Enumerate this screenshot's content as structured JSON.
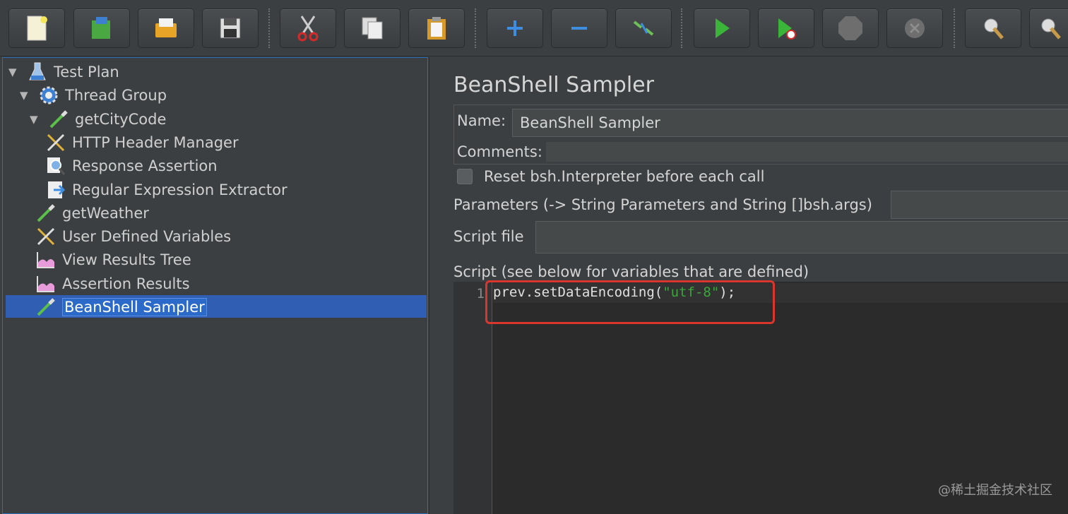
{
  "toolbar": {
    "buttons": [
      {
        "name": "new",
        "icon": "new-file-icon"
      },
      {
        "name": "templates",
        "icon": "templates-icon"
      },
      {
        "name": "open",
        "icon": "open-folder-icon"
      },
      {
        "name": "save",
        "icon": "save-icon"
      },
      {
        "name": "cut",
        "icon": "cut-icon"
      },
      {
        "name": "copy",
        "icon": "copy-icon"
      },
      {
        "name": "paste",
        "icon": "paste-icon"
      },
      {
        "name": "expand",
        "icon": "plus-icon"
      },
      {
        "name": "collapse",
        "icon": "minus-icon"
      },
      {
        "name": "toggle",
        "icon": "toggle-icon"
      },
      {
        "name": "start",
        "icon": "play-icon"
      },
      {
        "name": "start-no-pauses",
        "icon": "play-no-timers-icon"
      },
      {
        "name": "stop",
        "icon": "stop-icon"
      },
      {
        "name": "shutdown",
        "icon": "shutdown-icon"
      },
      {
        "name": "clear",
        "icon": "broom-icon"
      },
      {
        "name": "clear-all",
        "icon": "broom-all-icon"
      }
    ]
  },
  "tree": {
    "items": [
      {
        "label": "Test Plan",
        "icon": "flask-icon",
        "arrow": "▼"
      },
      {
        "label": "Thread Group",
        "icon": "gear-icon",
        "arrow": "▼"
      },
      {
        "label": "getCityCode",
        "icon": "pipette-icon",
        "arrow": "▼"
      },
      {
        "label": "HTTP Header Manager",
        "icon": "tools-icon",
        "arrow": ""
      },
      {
        "label": "Response Assertion",
        "icon": "magnifier-icon",
        "arrow": ""
      },
      {
        "label": "Regular Expression Extractor",
        "icon": "extractor-icon",
        "arrow": ""
      },
      {
        "label": "getWeather",
        "icon": "pipette-icon",
        "arrow": ""
      },
      {
        "label": "User Defined Variables",
        "icon": "tools-icon",
        "arrow": ""
      },
      {
        "label": "View Results Tree",
        "icon": "graph-icon",
        "arrow": ""
      },
      {
        "label": "Assertion Results",
        "icon": "graph-icon",
        "arrow": ""
      },
      {
        "label": "BeanShell Sampler",
        "icon": "pipette-icon",
        "arrow": "",
        "selected": true
      }
    ]
  },
  "panel": {
    "title": "BeanShell Sampler",
    "name_label": "Name:",
    "name_value": "BeanShell Sampler",
    "comments_label": "Comments:",
    "reset_label": "Reset bsh.Interpreter before each call",
    "params_label": "Parameters (-> String Parameters and String []bsh.args)",
    "script_file_label": "Script file",
    "script_label": "Script (see below for variables that are defined)"
  },
  "editor": {
    "line_number": "1",
    "code_prefix": "prev.setDataEncoding(",
    "code_string": "\"utf-8\"",
    "code_suffix": ");"
  },
  "colors": {
    "selection": "#2f5eb3",
    "highlight_box": "#d9372e",
    "string_literal": "#3aa83a"
  },
  "watermark": "@稀土掘金技术社区"
}
